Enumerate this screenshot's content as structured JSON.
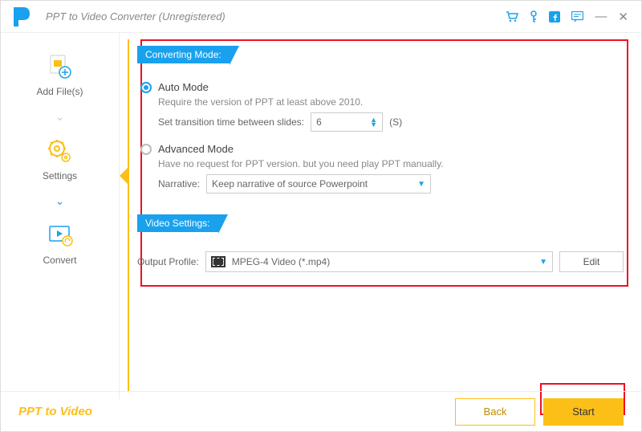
{
  "window": {
    "title": "PPT to Video Converter (Unregistered)"
  },
  "sidebar": {
    "items": [
      {
        "label": "Add File(s)"
      },
      {
        "label": "Settings"
      },
      {
        "label": "Convert"
      }
    ]
  },
  "sections": {
    "converting_mode": "Converting Mode:",
    "video_settings": "Video Settings:"
  },
  "auto_mode": {
    "title": "Auto Mode",
    "desc": "Require the version of PPT at least above 2010.",
    "trans_label": "Set transition time between slides:",
    "trans_value": "6",
    "trans_unit": "(S)"
  },
  "adv_mode": {
    "title": "Advanced Mode",
    "desc": "Have no request for PPT version. but you need play PPT manually.",
    "narr_label": "Narrative:",
    "narr_value": "Keep narrative of source Powerpoint"
  },
  "output": {
    "label": "Output Profile:",
    "value": "MPEG-4 Video (*.mp4)",
    "edit": "Edit"
  },
  "footer": {
    "brand": "PPT to Video",
    "back": "Back",
    "start": "Start"
  }
}
